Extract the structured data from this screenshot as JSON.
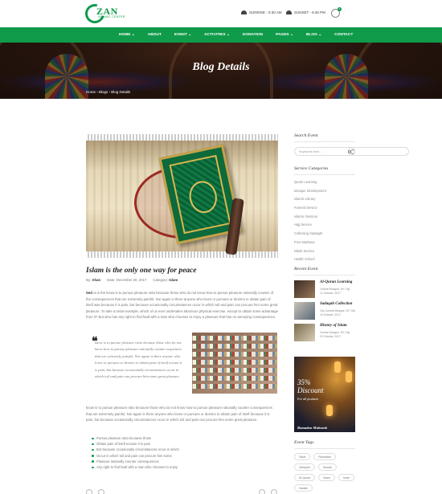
{
  "header": {
    "logo_text": "ZAN",
    "logo_sub": "ISLAMIC CENTER",
    "sunrise": "SUNRISE - 5:30 AM",
    "sunset": "SUNSET - 6:45 PM",
    "cart_count": "0"
  },
  "nav": {
    "items": [
      "HOME ⌄",
      "ABOUT",
      "EVENT ⌄",
      "ACTIVITIES ⌄",
      "DONATION",
      "PAGES ⌄",
      "BLOG ⌄",
      "CONTACT"
    ]
  },
  "hero": {
    "title": "Blog Details",
    "breadcrumb": "Home › Blogs › Blog Details"
  },
  "post": {
    "title": "Islam is the only one way for peace",
    "meta": {
      "by_label": "By:",
      "by_value": "Ahan",
      "date_label": "Date:",
      "date_value": "December 20, 2017",
      "category_label": "Category:",
      "category_value": "Islam"
    },
    "para1_lead": "Sed",
    "para1": "ut is the know is to pursue pleasure ratio because those who do not know how to pursue pleasure rationally counter of the consequences that are extremely painful. Nor again is there anyone who loves or pursues or desires to obtain pain of itself was because it is pain, but because occasionally circumstances occur in which toil and pain can procure him some great pleasure. To take a trivial example, which of us ever undertakes laborious physical exercise, except to obtain some advantage from it? But who has any right to find fault with a man who chooses to enjoy a pleasure that has no annoying consequences.",
    "quote": "know is to pursue pleasure ratio because those who do not know how to pursue pleasure rationally counter sequences that are extremely painful. Nor again is there anyone who loves or pursues or desires to obtain pain of itself ecause it is pain, but because occasionally circumstances occur in which toil and pain can procure him some great pleasure.",
    "para2": "know is to pursue pleasure ratio because those who do not know how to pursue pleasure rationally counter consequences that are extremely painful. Nor again is there anyone who loves or pursues or desires to obtain pain of itself because it is pain, but because occasionally circumstances occur in which toil and pain can procure him some great pleasure.",
    "list": [
      "Pursue pleasure ratio because those",
      "Obtain pain of itself ecause it is pain",
      "But because occasionally circumstances occur in which",
      "Occur in which toil and pain can procure him some",
      "Pleasure rationally counter consequences",
      "Any right to find fault with a man who chooses to enjoy"
    ]
  },
  "sidebar": {
    "search_title": "Search Event",
    "search_placeholder": "Keywords here...",
    "categories_title": "Service Categories",
    "categories": [
      "Quran Learning",
      "Mosque Development",
      "Islamic Library",
      "Funeral Service",
      "Islamic Seminar",
      "Hajj Service",
      "Collecting Sadaqah",
      "Free Madrasa",
      "Nikah Service",
      "Hadith School"
    ],
    "recent_title": "Recent Event",
    "recent": [
      {
        "title": "Al-Quran Learning",
        "sub1": "Central Mosque, NY City",
        "sub2": "12 October, 2017"
      },
      {
        "title": "Sadaqah Collection",
        "sub1": "City Central Mosque, NY City",
        "sub2": "15 October, 2017"
      },
      {
        "title": "History of Islam",
        "sub1": "Central Mosque, NY City",
        "sub2": "20 October, 2017"
      }
    ],
    "promo": {
      "percent": "35%",
      "discount": "Discount",
      "sub": "For all products",
      "footer": "Ramadan Mubarak"
    },
    "tags_title": "Event Tags",
    "tags": [
      "Salat",
      "Ramadan",
      "Zakayah",
      "Sawab",
      "Al-Quran",
      "Islam",
      "Iman",
      "Hadish"
    ]
  }
}
